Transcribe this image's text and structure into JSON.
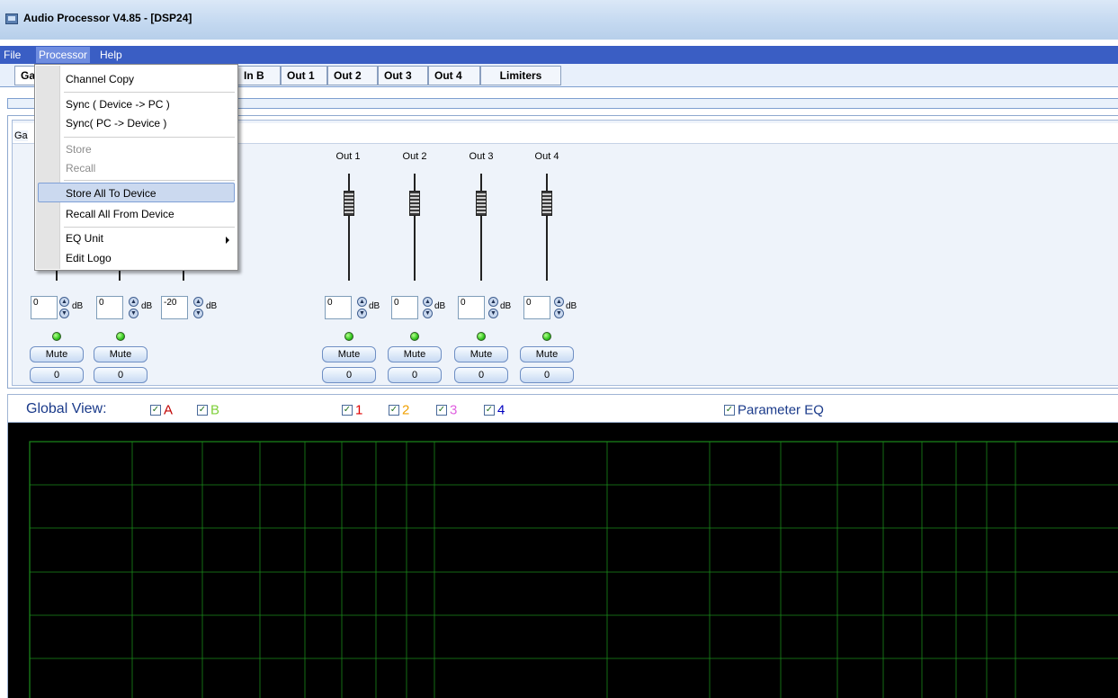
{
  "window": {
    "title": "Audio Processor V4.85 - [DSP24]"
  },
  "menubar": {
    "file": "File",
    "processor": "Processor",
    "help": "Help"
  },
  "tabs": [
    "Ga",
    "In B",
    "Out 1",
    "Out 2",
    "Out 3",
    "Out 4",
    "Limiters"
  ],
  "group_label": "Ga",
  "processor_menu": {
    "items": [
      "Channel Copy",
      "Sync ( Device -> PC )",
      "Sync( PC -> Device )",
      "Store",
      "Recall",
      "Store All To Device",
      "Recall All From Device",
      "EQ Unit",
      "Edit Logo"
    ],
    "highlighted": "Store All To Device",
    "disabled": [
      "Store",
      "Recall"
    ]
  },
  "faders": [
    {
      "label": "Out 1"
    },
    {
      "label": "Out 2"
    },
    {
      "label": "Out 3"
    },
    {
      "label": "Out 4"
    }
  ],
  "controls": [
    {
      "value": "0",
      "unit": "dB",
      "mute": "Mute",
      "btn": "0"
    },
    {
      "value": "0",
      "unit": "dB",
      "mute": "Mute",
      "btn": "0"
    },
    {
      "value": "-20",
      "unit": "dB"
    },
    {
      "value": "0",
      "unit": "dB",
      "mute": "Mute",
      "btn": "0"
    },
    {
      "value": "0",
      "unit": "dB",
      "mute": "Mute",
      "btn": "0"
    },
    {
      "value": "0",
      "unit": "dB",
      "mute": "Mute",
      "btn": "0"
    },
    {
      "value": "0",
      "unit": "dB",
      "mute": "Mute",
      "btn": "0"
    }
  ],
  "global_view": {
    "title": "Global View:",
    "checks": [
      {
        "label": "A",
        "color": "#c00000",
        "checked": true
      },
      {
        "label": "B",
        "color": "#7fd03a",
        "checked": true
      },
      {
        "label": "1",
        "color": "#e00000",
        "checked": true
      },
      {
        "label": "2",
        "color": "#f0a000",
        "checked": true
      },
      {
        "label": "3",
        "color": "#e060e0",
        "checked": true
      },
      {
        "label": "4",
        "color": "#0000c0",
        "checked": true
      },
      {
        "label": "Parameter EQ",
        "color": "#1a3a8a",
        "checked": true
      }
    ]
  },
  "colors": {
    "menubar": "#3a5ec4",
    "graph_bg": "#000000",
    "grid": "#1a8a1a"
  }
}
